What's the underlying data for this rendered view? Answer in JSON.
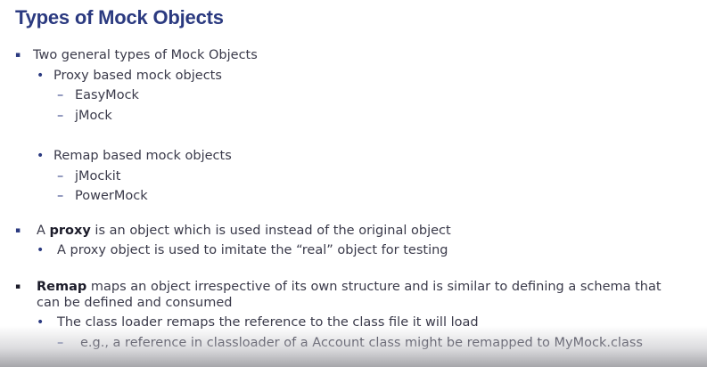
{
  "slide": {
    "title": "Types of Mock Objects",
    "b1": "Two general types of Mock Objects",
    "b1a": "Proxy based mock objects",
    "b1a1": "EasyMock",
    "b1a2": "jMock",
    "b1b": "Remap based mock objects",
    "b1b1": "jMockit",
    "b1b2": "PowerMock",
    "b2_pre": "A ",
    "b2_bold": "proxy",
    "b2_post": " is an object which is used instead of the original object",
    "b2a": "A proxy object is used to imitate the “real” object for testing",
    "b3_bold": "Remap",
    "b3_post": " maps an object irrespective of its own structure and is similar to defining a schema that",
    "b3_cont": "can be defined and consumed",
    "b3a": "The class loader remaps the reference to the class file it will load",
    "b3a1": "e.g., a reference in classloader of a Account class might be remapped to MyMock.class"
  },
  "bullets": {
    "square": "▪",
    "dot": "•",
    "dash": "–"
  }
}
